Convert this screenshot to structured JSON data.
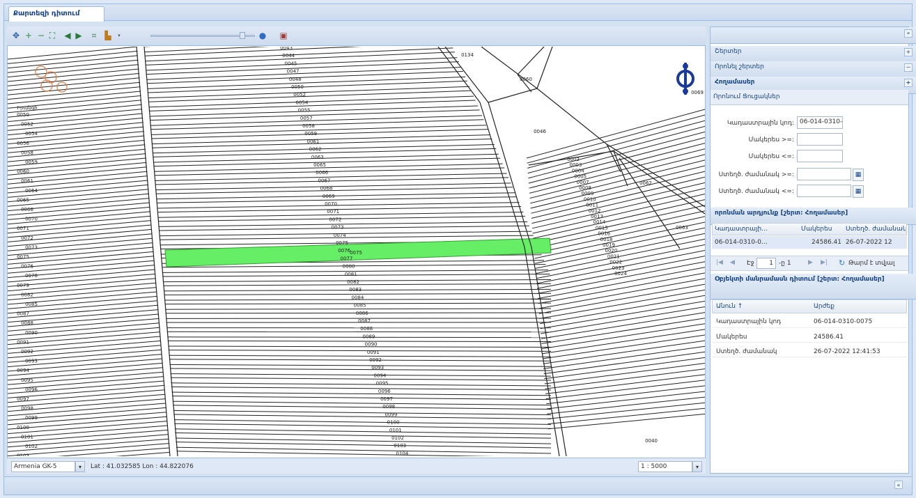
{
  "tab": {
    "label": "Քարտեզի դիտում"
  },
  "map": {
    "parcel_labels": [
      "0043",
      "0044",
      "0045",
      "0047",
      "0048",
      "0050",
      "0052",
      "0054",
      "0055",
      "0057",
      "0058",
      "0059",
      "0061",
      "0062",
      "0063",
      "0065",
      "0066",
      "0067",
      "0068",
      "0069",
      "0070",
      "0071",
      "0072",
      "0073",
      "0074",
      "0075",
      "0076",
      "0077",
      "0080",
      "0081",
      "0082",
      "0083",
      "0084",
      "0085",
      "0086",
      "0087",
      "0088",
      "0089",
      "0090",
      "0091",
      "0092",
      "0093",
      "0094",
      "0095",
      "0096",
      "0097",
      "0098",
      "0099",
      "0100",
      "0101",
      "0102",
      "0103",
      "0104"
    ],
    "highlighted_label": "0075",
    "top_labels": {
      "a": "0134",
      "b": "0060",
      "c": "0046",
      "d": "0069",
      "e": "0062",
      "f": "0063",
      "g": "0040"
    },
    "right_labels": [
      "0002",
      "0003",
      "0004",
      "0005",
      "0007",
      "0008",
      "0009",
      "0010",
      "0011",
      "0012",
      "0013",
      "0014",
      "0015",
      "0016",
      "0018",
      "0019",
      "0020",
      "0021",
      "0022",
      "0023",
      "0024"
    ],
    "left_labels": [
      "0050",
      "0052",
      "0054",
      "0056",
      "0058",
      "0059",
      "0060",
      "0061",
      "0064",
      "0065",
      "0066",
      "0070",
      "0071",
      "0072",
      "0073",
      "0075",
      "0076",
      "0078",
      "0079",
      "0082",
      "0085",
      "0087",
      "0088",
      "0090",
      "0091",
      "0092",
      "0093",
      "0094",
      "0095",
      "0096",
      "0097",
      "0098",
      "0099",
      "0100",
      "0101",
      "0102",
      "0103",
      "0104"
    ],
    "left_extra": "Իրանցի"
  },
  "statusbar": {
    "projection": "Armenia GK-5",
    "coords": "Lat : 41.032585  Lon : 44.822076",
    "scale": "1 : 5000"
  },
  "panel": {
    "sections": {
      "layers": "Շերտեր",
      "layer_search": "Որոնել շերտեր",
      "parcels": "Հողամասեր"
    },
    "tabs": {
      "search": "Որոնում",
      "results": "Ցուցակներ"
    },
    "form": {
      "cadastral_label": "Կադաստրային կոդ:",
      "cadastral_value": "06-014-0310-0075",
      "area_from_label": "Մակերես >=:",
      "area_to_label": "Մակերես <=:",
      "date_from_label": "Ստեղծ. ժամանակ >=:",
      "date_to_label": "Ստեղծ. ժամանակ <=:"
    },
    "results_title": "որոնման արդյունք [շերտ: Հողամասեր]",
    "results_columns": [
      "Կադաստրայի...",
      "Մակերես",
      "Ստեղծ. ժամանակ"
    ],
    "results_row": {
      "code": "06-014-0310-0...",
      "area": "24586.41",
      "date": "26-07-2022 12"
    },
    "pager": {
      "page_label": "Էջ",
      "page_value": "1",
      "of": "-ը 1",
      "refresh": "Թարմ է տվյալ"
    },
    "attr_title": "Օբյեկտի մանրամասն դիտում [շերտ: Հողամասեր]",
    "attr_columns": [
      "Անուն ↑",
      "Արժեք"
    ],
    "attr_rows": [
      {
        "name": "Կադաստրային կոդ",
        "value": "06-014-0310-0075"
      },
      {
        "name": "Մակերես",
        "value": "24586.41"
      },
      {
        "name": "Ստեղծ. ժամանակ",
        "value": "26-07-2022 12:41:53"
      }
    ]
  }
}
